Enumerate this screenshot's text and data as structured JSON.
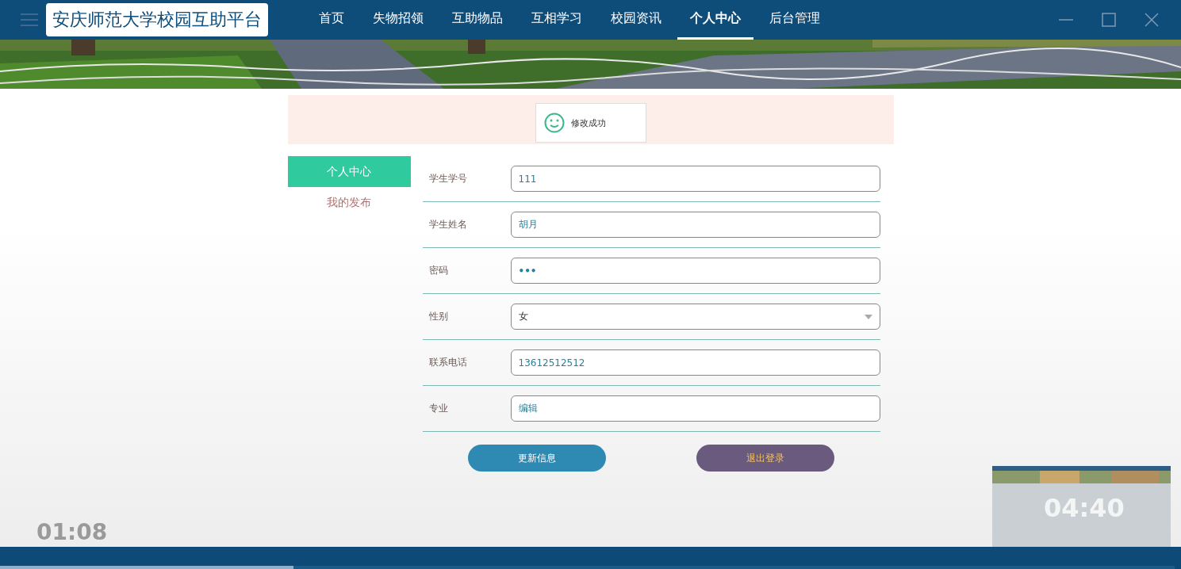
{
  "header": {
    "logo": "安庆师范大学校园互助平台",
    "nav": [
      {
        "label": "首页",
        "selected": false
      },
      {
        "label": "失物招领",
        "selected": false
      },
      {
        "label": "互助物品",
        "selected": false
      },
      {
        "label": "互相学习",
        "selected": false
      },
      {
        "label": "校园资讯",
        "selected": false
      },
      {
        "label": "个人中心",
        "selected": true
      },
      {
        "label": "后台管理",
        "selected": false
      }
    ]
  },
  "toast": {
    "message": "修改成功"
  },
  "sidebar": [
    {
      "label": "个人中心",
      "selected": true
    },
    {
      "label": "我的发布",
      "selected": false
    }
  ],
  "form": {
    "fields": [
      {
        "label": "学生学号",
        "kind": "text",
        "value": "111"
      },
      {
        "label": "学生姓名",
        "kind": "text",
        "value": "胡月"
      },
      {
        "label": "密码",
        "kind": "password",
        "value": "•••"
      },
      {
        "label": "性别",
        "kind": "select",
        "value": "女"
      },
      {
        "label": "联系电话",
        "kind": "text",
        "value": "13612512512"
      },
      {
        "label": "专业",
        "kind": "text",
        "value": "编辑"
      }
    ],
    "buttons": [
      {
        "label": "更新信息",
        "kind": "primary"
      },
      {
        "label": "退出登录",
        "kind": "secondary"
      }
    ]
  },
  "video": {
    "current_time": "01:08",
    "preview_time": "04:40",
    "level": 0.25
  }
}
